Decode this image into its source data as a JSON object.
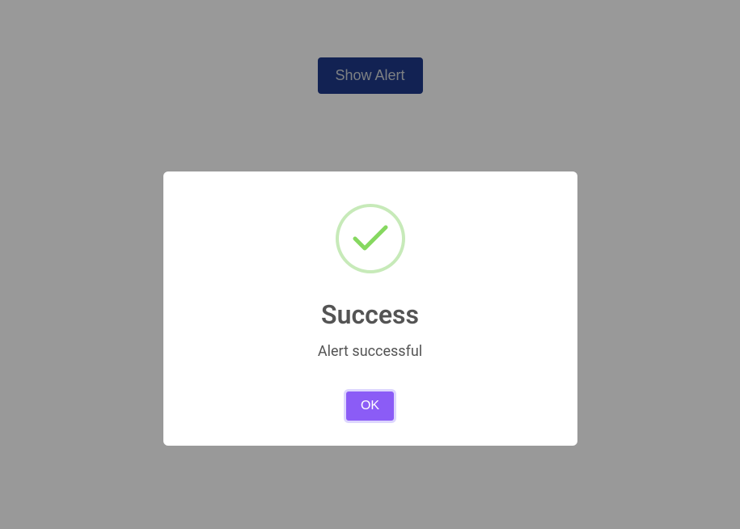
{
  "trigger": {
    "label": "Show Alert"
  },
  "modal": {
    "title": "Success",
    "message": "Alert successful",
    "confirm_label": "OK"
  },
  "colors": {
    "trigger_bg": "#1e3a8a",
    "ok_bg": "#8b5cf6",
    "success_icon": "#86d860"
  }
}
